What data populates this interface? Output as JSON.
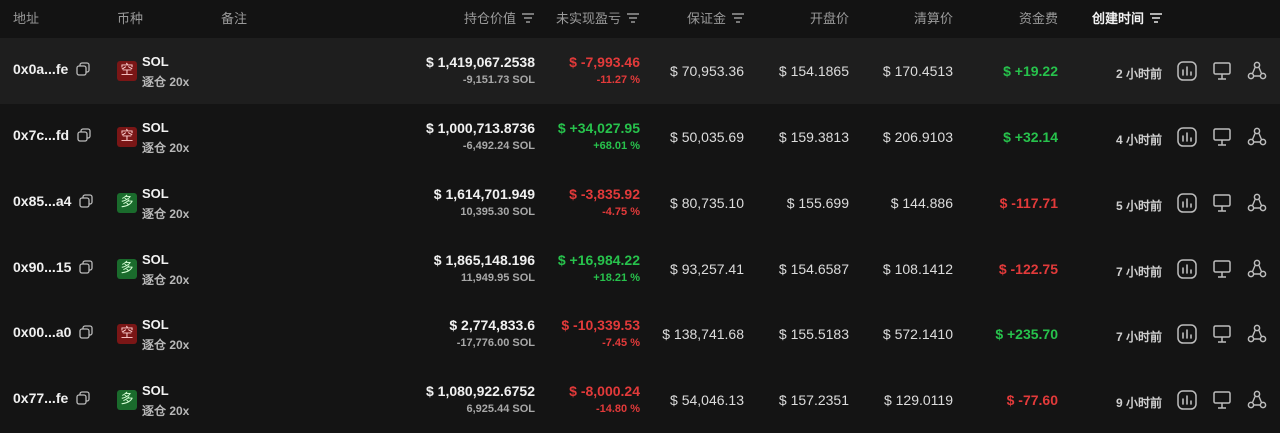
{
  "header": {
    "address": "地址",
    "coin": "币种",
    "note": "备注",
    "position_value": "持仓价值",
    "unrealized_pnl": "未实现盈亏",
    "margin": "保证金",
    "entry_price": "开盘价",
    "liq_price": "清算价",
    "funding": "资金费",
    "created_time": "创建时间"
  },
  "colors": {
    "negative": "#e23a3a",
    "positive": "#27c24c",
    "short_badge": "#7a1616",
    "long_badge": "#1a6b2c"
  },
  "icons": [
    "copy-icon",
    "sort-icon",
    "chart-icon",
    "monitor-icon",
    "share-icon"
  ],
  "rows": [
    {
      "address": "0x0a...fe",
      "side": "空",
      "side_type": "short",
      "coin": "SOL",
      "leverage": "逐仓 20x",
      "value": "$ 1,419,067.2538",
      "size": "-9,151.73 SOL",
      "pnl": "$ -7,993.46",
      "pnl_pct": "-11.27 %",
      "pnl_dir": "neg",
      "margin": "$ 70,953.36",
      "entry": "$ 154.1865",
      "liq": "$ 170.4513",
      "funding": "$ +19.22",
      "funding_dir": "pos",
      "time": "2 小时前"
    },
    {
      "address": "0x7c...fd",
      "side": "空",
      "side_type": "short",
      "coin": "SOL",
      "leverage": "逐仓 20x",
      "value": "$ 1,000,713.8736",
      "size": "-6,492.24 SOL",
      "pnl": "$ +34,027.95",
      "pnl_pct": "+68.01 %",
      "pnl_dir": "pos",
      "margin": "$ 50,035.69",
      "entry": "$ 159.3813",
      "liq": "$ 206.9103",
      "funding": "$ +32.14",
      "funding_dir": "pos",
      "time": "4 小时前"
    },
    {
      "address": "0x85...a4",
      "side": "多",
      "side_type": "long",
      "coin": "SOL",
      "leverage": "逐仓 20x",
      "value": "$ 1,614,701.949",
      "size": "10,395.30 SOL",
      "pnl": "$ -3,835.92",
      "pnl_pct": "-4.75 %",
      "pnl_dir": "neg",
      "margin": "$ 80,735.10",
      "entry": "$ 155.699",
      "liq": "$ 144.886",
      "funding": "$ -117.71",
      "funding_dir": "neg",
      "time": "5 小时前"
    },
    {
      "address": "0x90...15",
      "side": "多",
      "side_type": "long",
      "coin": "SOL",
      "leverage": "逐仓 20x",
      "value": "$ 1,865,148.196",
      "size": "11,949.95 SOL",
      "pnl": "$ +16,984.22",
      "pnl_pct": "+18.21 %",
      "pnl_dir": "pos",
      "margin": "$ 93,257.41",
      "entry": "$ 154.6587",
      "liq": "$ 108.1412",
      "funding": "$ -122.75",
      "funding_dir": "neg",
      "time": "7 小时前"
    },
    {
      "address": "0x00...a0",
      "side": "空",
      "side_type": "short",
      "coin": "SOL",
      "leverage": "逐仓 20x",
      "value": "$ 2,774,833.6",
      "size": "-17,776.00 SOL",
      "pnl": "$ -10,339.53",
      "pnl_pct": "-7.45 %",
      "pnl_dir": "neg",
      "margin": "$ 138,741.68",
      "entry": "$ 155.5183",
      "liq": "$ 572.1410",
      "funding": "$ +235.70",
      "funding_dir": "pos",
      "time": "7 小时前"
    },
    {
      "address": "0x77...fe",
      "side": "多",
      "side_type": "long",
      "coin": "SOL",
      "leverage": "逐仓 20x",
      "value": "$ 1,080,922.6752",
      "size": "6,925.44 SOL",
      "pnl": "$ -8,000.24",
      "pnl_pct": "-14.80 %",
      "pnl_dir": "neg",
      "margin": "$ 54,046.13",
      "entry": "$ 157.2351",
      "liq": "$ 129.0119",
      "funding": "$ -77.60",
      "funding_dir": "neg",
      "time": "9 小时前"
    }
  ]
}
